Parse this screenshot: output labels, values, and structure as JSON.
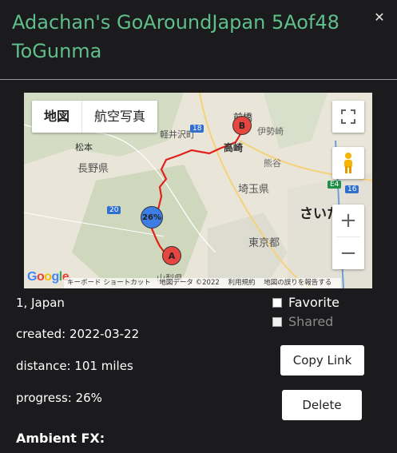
{
  "title": "Adachan's GoAroundJapan 5Aof48 ToGunma",
  "map": {
    "type_tabs": [
      "地図",
      "航空写真"
    ],
    "markers": {
      "start": "A",
      "end": "B",
      "progress": "26%"
    },
    "labels": {
      "maebashi": "前橋",
      "takasaki": "高崎",
      "matsumoto": "松本",
      "nagano": "長野県",
      "saitama_pref": "埼玉県",
      "saitama": "さいた",
      "tokyo": "東京都",
      "yamanashi": "山梨県",
      "route16": "16",
      "route18": "18",
      "route20": "20",
      "e4": "E4",
      "karuizawa": "軽井沢町",
      "isesaki": "伊勢崎",
      "kumagaya": "熊谷"
    },
    "logo": "Google",
    "attribution": [
      "キーボード ショートカット",
      "地図データ ©2022",
      "利用規約",
      "地図の誤りを報告する"
    ],
    "zoom_in": "+",
    "zoom_out": "−"
  },
  "info": {
    "location": "1, Japan",
    "created": "created: 2022-03-22",
    "distance": "distance: 101 miles",
    "progress": "progress: 26%",
    "ambient": "Ambient FX:"
  },
  "options": {
    "favorite": "Favorite",
    "shared": "Shared"
  },
  "buttons": {
    "copy": "Copy Link",
    "delete": "Delete"
  },
  "colors": {
    "title": "#5fbf8a",
    "route": "#e0201b",
    "marker_end": "#e5463f",
    "marker_progress": "#3d7ee6"
  }
}
